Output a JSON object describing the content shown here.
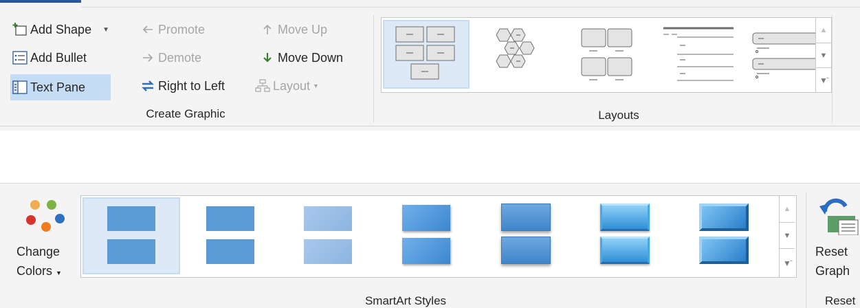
{
  "create_graphic": {
    "add_shape_label": "Add Shape",
    "add_bullet_label": "Add Bullet",
    "text_pane_label": "Text Pane",
    "promote_label": "Promote",
    "demote_label": "Demote",
    "right_to_left_label": "Right to Left",
    "move_up_label": "Move Up",
    "move_down_label": "Move Down",
    "layout_label": "Layout",
    "group_label": "Create Graphic"
  },
  "layouts": {
    "group_label": "Layouts"
  },
  "smartart_styles": {
    "change_colors_line1": "Change",
    "change_colors_line2": "Colors",
    "group_label": "SmartArt Styles"
  },
  "reset": {
    "reset_graphic_line1": "Reset",
    "reset_graphic_line2": "Graph",
    "group_label": "Reset"
  },
  "colors": {
    "accent": "#2b579a",
    "selected_bg": "#c5dcf5",
    "shape_blue": "#5b9bd5",
    "move_down_arrow": "#3a7d2a",
    "right_to_left_arrow": "#2b6cc4"
  }
}
